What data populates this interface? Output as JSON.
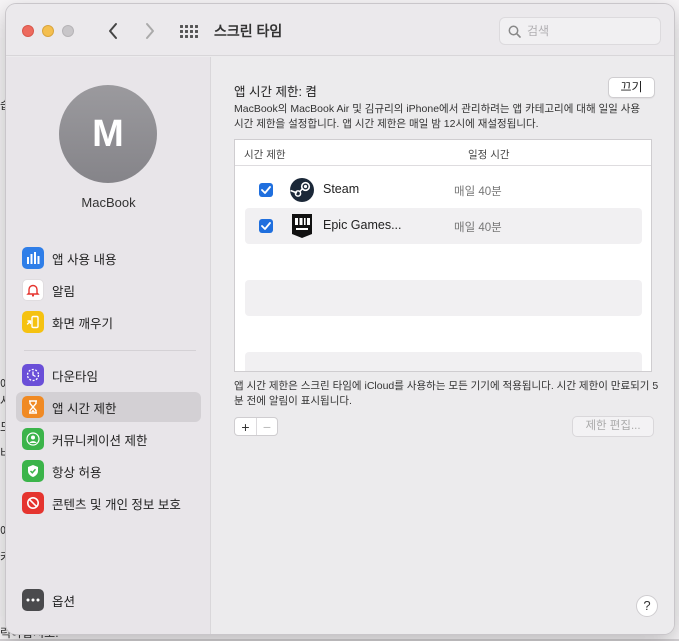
{
  "window": {
    "title": "스크린 타임"
  },
  "search": {
    "placeholder": "검색"
  },
  "background_fragments": [
    "습",
    "에",
    "사",
    "도",
    "비",
    "에",
    "카",
    "럭아합시오."
  ],
  "sidebar": {
    "avatar_initial": "M",
    "device_name": "MacBook",
    "items": [
      {
        "label": "앱 사용 내용",
        "icon": "app-usage-icon",
        "color": "#2f7ee8"
      },
      {
        "label": "알림",
        "icon": "bell-icon",
        "color": "#ffffff"
      },
      {
        "label": "화면 깨우기",
        "icon": "pickups-icon",
        "color": "#f5c211"
      },
      {
        "label": "다운타임",
        "icon": "downtime-icon",
        "color": "#6a4fd8"
      },
      {
        "label": "앱 시간 제한",
        "icon": "hourglass-icon",
        "color": "#f08a24"
      },
      {
        "label": "커뮤니케이션 제한",
        "icon": "communication-icon",
        "color": "#3bb44a"
      },
      {
        "label": "항상 허용",
        "icon": "always-allowed-icon",
        "color": "#3bb44a"
      },
      {
        "label": "콘텐츠 및 개인 정보 보호",
        "icon": "restriction-icon",
        "color": "#e5342f"
      },
      {
        "label": "옵션",
        "icon": "options-icon",
        "color": "#4a4a4d"
      }
    ],
    "active_index": 4
  },
  "main": {
    "heading": "앱 시간 제한: 켬",
    "off_button": "끄기",
    "description": "MacBook의 MacBook Air 및 김규리의 iPhone에서 관리하려는 앱 카테고리에 대해 일일 사용 시간 제한을 설정합니다. 앱 시간 제한은 매일 밤 12시에 재설정됩니다.",
    "table": {
      "columns": [
        "시간 제한",
        "일정 시간"
      ],
      "rows": [
        {
          "checked": true,
          "name": "Steam",
          "limit": "매일 40분",
          "icon": "steam-icon"
        },
        {
          "checked": true,
          "name": "Epic Games...",
          "limit": "매일 40분",
          "icon": "epic-games-icon"
        }
      ]
    },
    "footnote": "앱 시간 제한은 스크린 타임에 iCloud를 사용하는 모든 기기에 적용됩니다. 시간 제한이 만료되기 5분 전에 알림이 표시됩니다.",
    "add_label": "+",
    "remove_label": "−",
    "edit_button": "제한 편집...",
    "help_label": "?"
  },
  "colors": {
    "accent": "#1f6fde",
    "window_bg": "#ecebed"
  }
}
